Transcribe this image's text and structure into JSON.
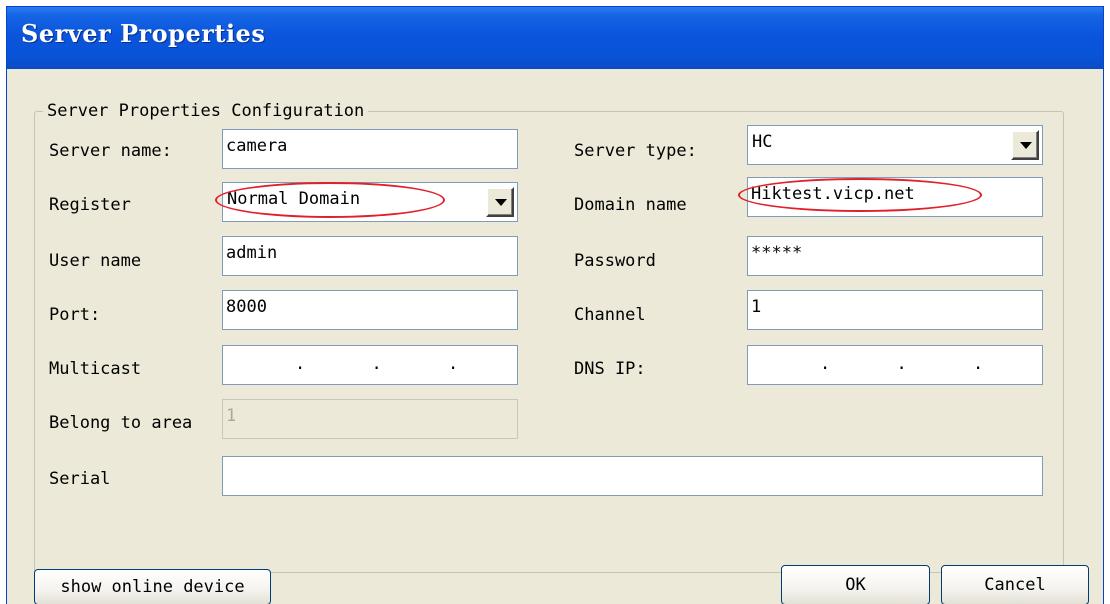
{
  "window": {
    "title": "Server Properties"
  },
  "group": {
    "legend": "Server Properties Configuration"
  },
  "fields": {
    "server_name": {
      "label": "Server name:",
      "value": "camera"
    },
    "server_type": {
      "label": "Server type:",
      "value": "HC"
    },
    "register": {
      "label": "Register",
      "value": "Normal Domain"
    },
    "domain_name": {
      "label": "Domain name",
      "value": "Hiktest.vicp.net"
    },
    "user_name": {
      "label": "User name",
      "value": "admin"
    },
    "password": {
      "label": "Password",
      "value": "*****"
    },
    "port": {
      "label": "Port:",
      "value": "8000"
    },
    "channel": {
      "label": "Channel",
      "value": "1"
    },
    "multicast": {
      "label": "Multicast",
      "dots": ".   .   ."
    },
    "dns_ip": {
      "label": "DNS IP:",
      "dots": ".   .   ."
    },
    "belong_to_area": {
      "label": "Belong to area",
      "value": "1"
    },
    "serial": {
      "label": "Serial",
      "value": ""
    }
  },
  "buttons": {
    "show_online": "show online device",
    "ok": "OK",
    "cancel": "Cancel"
  },
  "colors": {
    "title_bar": "#0a55dc",
    "dialog_bg": "#ece9d8",
    "annotation": "#e0202a"
  }
}
